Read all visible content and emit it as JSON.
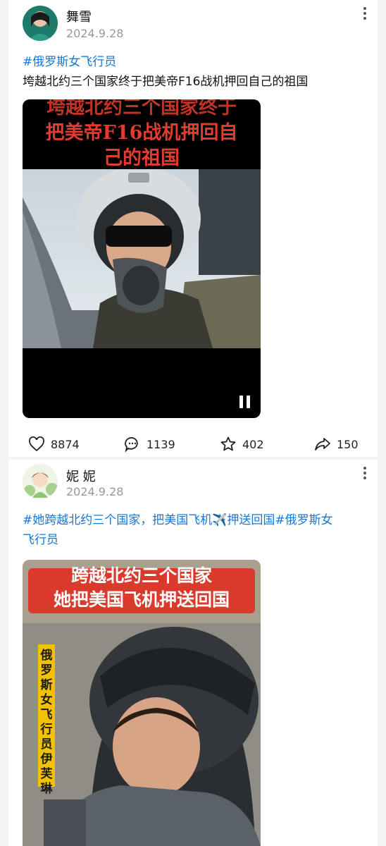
{
  "posts": [
    {
      "author": "舞雪",
      "date": "2024.9.28",
      "hashtag": "#俄罗斯女飞行员",
      "caption": "垮越北约三个国家终于把美帝F16战机押回自己的祖国",
      "video_title_line1": "垮越北约三个国家终于",
      "video_title_line2": "把美帝F16战机押回自",
      "video_title_line3": "己的祖国",
      "stats": {
        "likes": "8874",
        "comments": "1139",
        "favorites": "402",
        "shares": "150"
      }
    },
    {
      "author": "妮 妮",
      "date": "2024.9.28",
      "text_tag1": "#她跨越北约三个国家，把美国飞机",
      "text_emoji": "✈️",
      "text_tag2": "押送回国#俄罗斯女",
      "text_line2": "飞行员",
      "image_title_line1": "跨越北约三个国家",
      "image_title_line2": "她把美国飞机押送回国",
      "image_side_label": "俄罗斯女飞行员伊芙琳"
    }
  ],
  "colors": {
    "hashtag": "#1677d6",
    "title_red": "#e33b2e",
    "banner_red": "#d93a2c",
    "side_label_bg": "#f2c200"
  },
  "icons": [
    "more-vertical-icon",
    "heart-icon",
    "comment-icon",
    "star-icon",
    "share-icon",
    "pause-icon"
  ]
}
